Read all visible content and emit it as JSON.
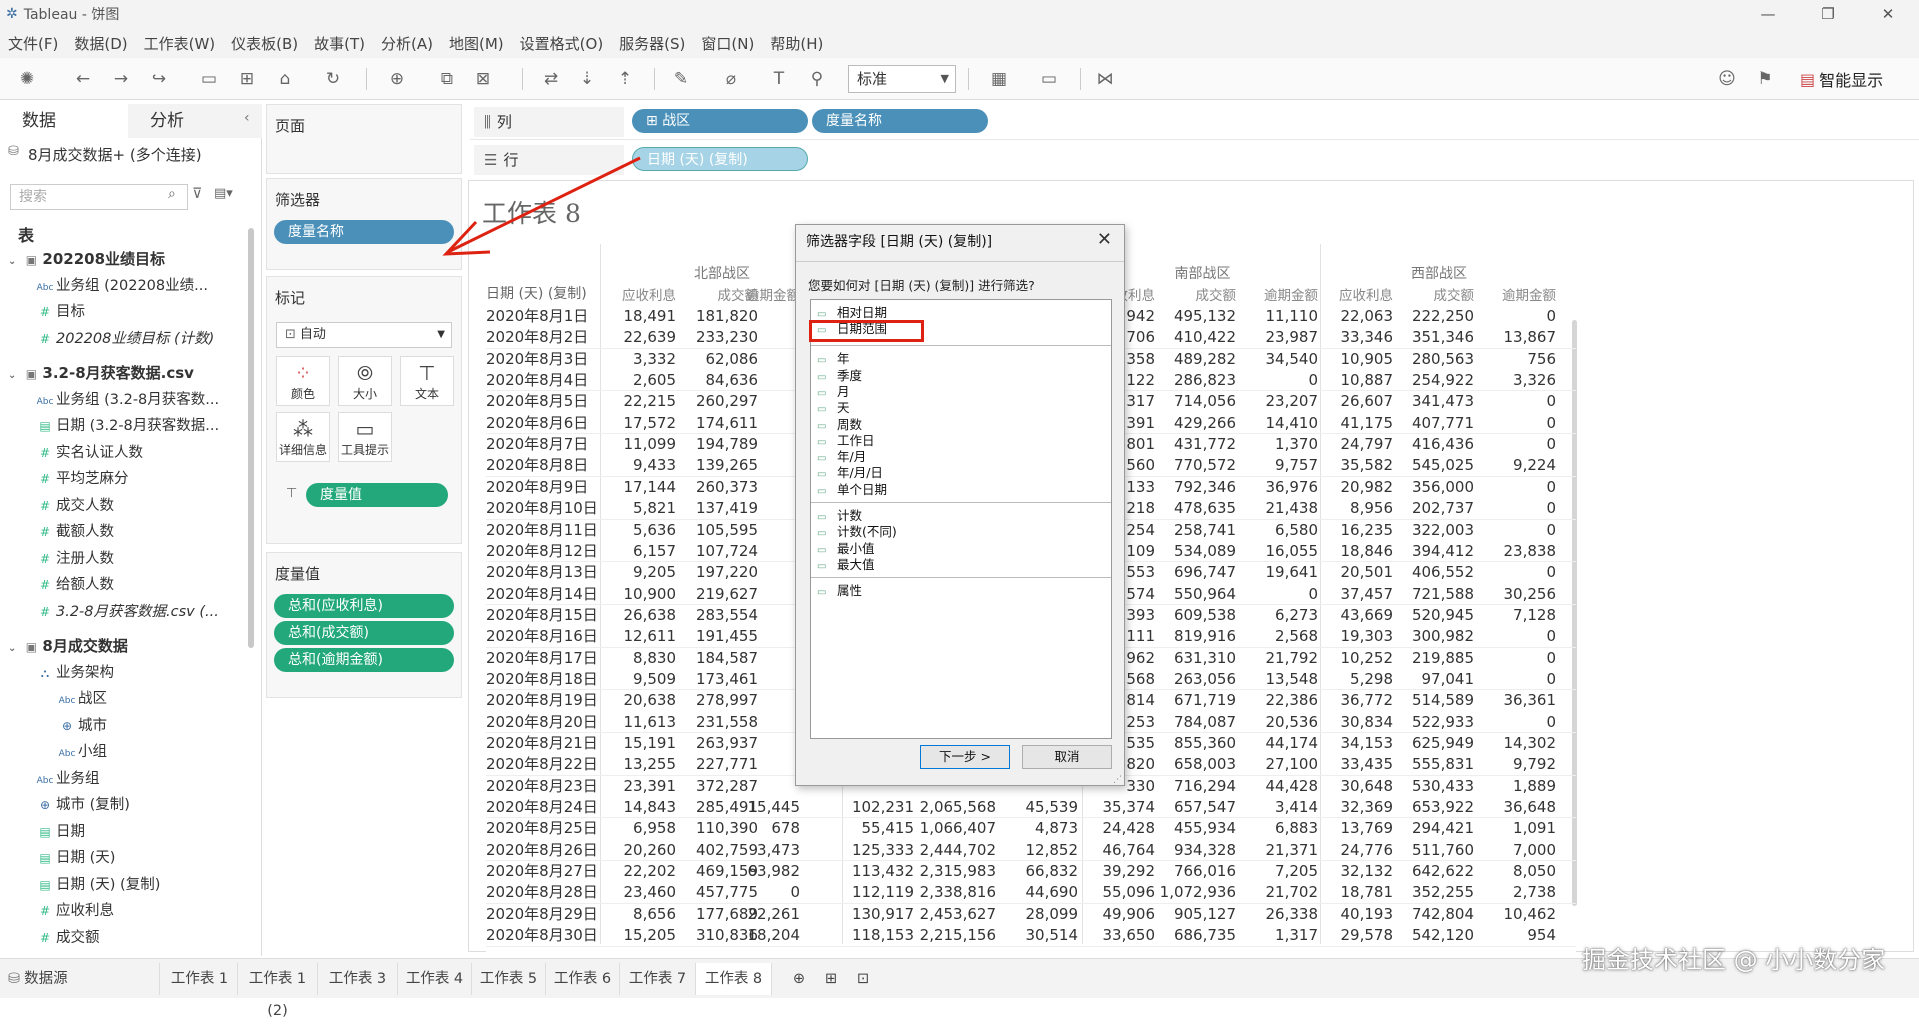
{
  "app": {
    "title": "Tableau - 饼图",
    "logo": "tableau-logo-icon"
  },
  "menu": [
    "文件(F)",
    "数据(D)",
    "工作表(W)",
    "仪表板(B)",
    "故事(T)",
    "分析(A)",
    "地图(M)",
    "设置格式(O)",
    "服务器(S)",
    "窗口(N)",
    "帮助(H)"
  ],
  "toolbar": {
    "fit_select": "标准",
    "smart_show": "智能显示"
  },
  "left": {
    "tabs": [
      "数据",
      "分析"
    ],
    "connection": "8月成交数据+ (多个连接)",
    "search_placeholder": "搜索",
    "section_label": "表",
    "fields": [
      {
        "text": "202208业绩目标",
        "kind": "table"
      },
      {
        "text": "业务组 (202208业绩...",
        "kind": "abc"
      },
      {
        "text": "目标",
        "kind": "num"
      },
      {
        "text": "202208业绩目标 (计数)",
        "kind": "num-it"
      },
      {
        "text": "3.2-8月获客数据.csv",
        "kind": "table"
      },
      {
        "text": "业务组 (3.2-8月获客数...",
        "kind": "abc"
      },
      {
        "text": "日期 (3.2-8月获客数据...",
        "kind": "date"
      },
      {
        "text": "实名认证人数",
        "kind": "num"
      },
      {
        "text": "平均芝麻分",
        "kind": "num"
      },
      {
        "text": "成交人数",
        "kind": "num"
      },
      {
        "text": "截额人数",
        "kind": "num"
      },
      {
        "text": "注册人数",
        "kind": "num"
      },
      {
        "text": "给额人数",
        "kind": "num"
      },
      {
        "text": "3.2-8月获客数据.csv (...",
        "kind": "num-it"
      },
      {
        "text": "8月成交数据",
        "kind": "table"
      },
      {
        "text": "业务架构",
        "kind": "hier"
      },
      {
        "text": "战区",
        "kind": "abc2"
      },
      {
        "text": "城市",
        "kind": "geo2"
      },
      {
        "text": "小组",
        "kind": "abc2"
      },
      {
        "text": "业务组",
        "kind": "abc"
      },
      {
        "text": "城市 (复制)",
        "kind": "geo"
      },
      {
        "text": "日期",
        "kind": "date"
      },
      {
        "text": "日期 (天)",
        "kind": "date"
      },
      {
        "text": "日期 (天) (复制)",
        "kind": "date"
      },
      {
        "text": "应收利息",
        "kind": "num"
      },
      {
        "text": "成交额",
        "kind": "num"
      }
    ]
  },
  "cards": {
    "pages": "页面",
    "filters": "筛选器",
    "filter_pill": "度量名称",
    "marks": "标记",
    "marks_type": "自动",
    "mark_buttons": [
      "颜色",
      "大小",
      "文本",
      "详细信息",
      "工具提示"
    ],
    "marks_pill": "度量值",
    "measure_values": "度量值",
    "measure_pills": [
      "总和(应收利息)",
      "总和(成交额)",
      "总和(逾期金额)"
    ]
  },
  "shelves": {
    "columns_label": "列",
    "rows_label": "行",
    "col_pills": [
      "战区",
      "度量名称"
    ],
    "row_pills": [
      "日期 (天) (复制)"
    ]
  },
  "worksheet": {
    "title": "工作表 8",
    "row_header": "日期 (天) (复制)",
    "regions": [
      "北部战区",
      "南部战区",
      "西部战区"
    ],
    "measures": [
      "应收利息",
      "成交额",
      "逾期金额"
    ],
    "dates": [
      "2020年8月1日",
      "2020年8月2日",
      "2020年8月3日",
      "2020年8月4日",
      "2020年8月5日",
      "2020年8月6日",
      "2020年8月7日",
      "2020年8月8日",
      "2020年8月9日",
      "2020年8月10日",
      "2020年8月11日",
      "2020年8月12日",
      "2020年8月13日",
      "2020年8月14日",
      "2020年8月15日",
      "2020年8月16日",
      "2020年8月17日",
      "2020年8月18日",
      "2020年8月19日",
      "2020年8月20日",
      "2020年8月21日",
      "2020年8月22日",
      "2020年8月23日",
      "2020年8月24日",
      "2020年8月25日",
      "2020年8月26日",
      "2020年8月27日",
      "2020年8月28日",
      "2020年8月29日",
      "2020年8月30日"
    ],
    "north": [
      [
        "18,491",
        "181,820"
      ],
      [
        "22,639",
        "233,230"
      ],
      [
        "3,332",
        "62,086"
      ],
      [
        "2,605",
        "84,636"
      ],
      [
        "22,215",
        "260,297"
      ],
      [
        "17,572",
        "174,611"
      ],
      [
        "11,099",
        "194,789"
      ],
      [
        "9,433",
        "139,265"
      ],
      [
        "17,144",
        "260,373"
      ],
      [
        "5,821",
        "137,419"
      ],
      [
        "5,636",
        "105,595"
      ],
      [
        "6,157",
        "107,724"
      ],
      [
        "9,205",
        "197,220"
      ],
      [
        "10,900",
        "219,627"
      ],
      [
        "26,638",
        "283,554"
      ],
      [
        "12,611",
        "191,455"
      ],
      [
        "8,830",
        "184,587"
      ],
      [
        "9,509",
        "173,461"
      ],
      [
        "20,638",
        "278,997"
      ],
      [
        "11,613",
        "231,558"
      ],
      [
        "15,191",
        "263,937"
      ],
      [
        "13,255",
        "227,771"
      ],
      [
        "23,391",
        "372,287"
      ],
      [
        "14,843",
        "285,491",
        "15,445"
      ],
      [
        "6,958",
        "110,390",
        "678"
      ],
      [
        "20,260",
        "402,759",
        "3,473"
      ],
      [
        "22,202",
        "469,159",
        "63,982"
      ],
      [
        "23,460",
        "457,775",
        "0"
      ],
      [
        "8,656",
        "177,689",
        "22,261"
      ],
      [
        "15,205",
        "310,836",
        "18,204"
      ]
    ],
    "middle": [
      [],
      [],
      [],
      [],
      [],
      [],
      [],
      [],
      [],
      [],
      [],
      [],
      [],
      [],
      [],
      [],
      [],
      [],
      [],
      [],
      [],
      [],
      [],
      [
        "102,231",
        "2,065,568",
        "45,539"
      ],
      [
        "55,415",
        "1,066,407",
        "4,873"
      ],
      [
        "125,333",
        "2,444,702",
        "12,852"
      ],
      [
        "113,432",
        "2,315,983",
        "66,832"
      ],
      [
        "112,119",
        "2,338,816",
        "44,690"
      ],
      [
        "130,917",
        "2,453,627",
        "28,099"
      ],
      [
        "118,153",
        "2,215,156",
        "30,514"
      ]
    ],
    "south": [
      [
        "942",
        "495,132",
        "11,110"
      ],
      [
        "706",
        "410,422",
        "23,987"
      ],
      [
        "358",
        "489,282",
        "34,540"
      ],
      [
        "122",
        "286,823",
        "0"
      ],
      [
        "317",
        "714,056",
        "23,207"
      ],
      [
        "391",
        "429,266",
        "14,410"
      ],
      [
        "801",
        "431,772",
        "1,370"
      ],
      [
        "560",
        "770,572",
        "9,757"
      ],
      [
        "133",
        "792,346",
        "36,976"
      ],
      [
        "218",
        "478,635",
        "21,438"
      ],
      [
        "254",
        "258,741",
        "6,580"
      ],
      [
        "109",
        "534,089",
        "16,055"
      ],
      [
        "553",
        "696,747",
        "19,641"
      ],
      [
        "574",
        "550,964",
        "0"
      ],
      [
        "393",
        "609,538",
        "6,273"
      ],
      [
        "111",
        "819,916",
        "2,568"
      ],
      [
        "962",
        "631,310",
        "21,792"
      ],
      [
        "568",
        "263,056",
        "13,548"
      ],
      [
        "814",
        "671,719",
        "22,386"
      ],
      [
        "253",
        "784,087",
        "20,536"
      ],
      [
        "535",
        "855,360",
        "44,174"
      ],
      [
        "820",
        "658,003",
        "27,100"
      ],
      [
        "330",
        "716,294",
        "44,428"
      ],
      [
        "35,374",
        "657,547",
        "3,414"
      ],
      [
        "24,428",
        "455,934",
        "6,883"
      ],
      [
        "46,764",
        "934,328",
        "21,371"
      ],
      [
        "39,292",
        "766,016",
        "7,205"
      ],
      [
        "55,096",
        "1,072,936",
        "21,702"
      ],
      [
        "49,906",
        "905,127",
        "26,338"
      ],
      [
        "33,650",
        "686,735",
        "1,317"
      ]
    ],
    "west": [
      [
        "22,063",
        "222,250",
        "0"
      ],
      [
        "33,346",
        "351,346",
        "13,867"
      ],
      [
        "10,905",
        "280,563",
        "756"
      ],
      [
        "10,887",
        "254,922",
        "3,326"
      ],
      [
        "26,607",
        "341,473",
        "0"
      ],
      [
        "41,175",
        "407,771",
        "0"
      ],
      [
        "24,797",
        "416,436",
        "0"
      ],
      [
        "35,582",
        "545,025",
        "9,224"
      ],
      [
        "20,982",
        "356,000",
        "0"
      ],
      [
        "8,956",
        "202,737",
        "0"
      ],
      [
        "16,235",
        "322,003",
        "0"
      ],
      [
        "18,846",
        "394,412",
        "23,838"
      ],
      [
        "20,501",
        "406,552",
        "0"
      ],
      [
        "37,457",
        "721,588",
        "30,256"
      ],
      [
        "43,669",
        "520,945",
        "7,128"
      ],
      [
        "19,303",
        "300,982",
        "0"
      ],
      [
        "10,252",
        "219,885",
        "0"
      ],
      [
        "5,298",
        "97,041",
        "0"
      ],
      [
        "36,772",
        "514,589",
        "36,361"
      ],
      [
        "30,834",
        "522,933",
        "0"
      ],
      [
        "34,153",
        "625,949",
        "14,302"
      ],
      [
        "33,435",
        "555,831",
        "9,792"
      ],
      [
        "30,648",
        "530,433",
        "1,889"
      ],
      [
        "32,369",
        "653,922",
        "36,648"
      ],
      [
        "13,769",
        "294,421",
        "1,091"
      ],
      [
        "24,776",
        "511,760",
        "7,000"
      ],
      [
        "32,132",
        "642,622",
        "8,050"
      ],
      [
        "18,781",
        "352,255",
        "2,738"
      ],
      [
        "40,193",
        "742,804",
        "10,462"
      ],
      [
        "29,578",
        "542,120",
        "954"
      ]
    ]
  },
  "dialog": {
    "title": "筛选器字段 [日期 (天) (复制)]",
    "question": "您要如何对 [日期 (天) (复制)] 进行筛选?",
    "group1": [
      "相对日期",
      "日期范围"
    ],
    "group2": [
      "年",
      "季度",
      "月",
      "天",
      "周数",
      "工作日",
      "年/月",
      "年/月/日",
      "单个日期"
    ],
    "group3": [
      "计数",
      "计数(不同)",
      "最小值",
      "最大值"
    ],
    "group4": [
      "属性"
    ],
    "next": "下一步 >",
    "cancel": "取消"
  },
  "bottom": {
    "datasource": "数据源",
    "sheets": [
      "工作表 1",
      "工作表 1 (2)",
      "工作表 3",
      "工作表 4",
      "工作表 5",
      "工作表 6",
      "工作表 7",
      "工作表 8"
    ],
    "active": "工作表 8"
  },
  "watermark": "掘金技术社区 @ 小小数分家",
  "colors": {
    "pill_blue": "#4a90b8",
    "pill_green": "#22a87a",
    "annotation_red": "#d21"
  }
}
